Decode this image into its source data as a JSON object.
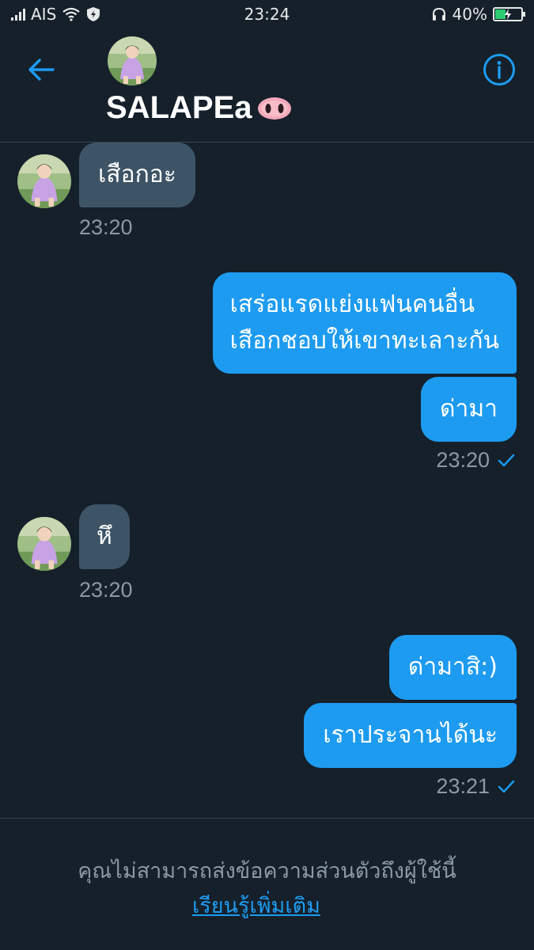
{
  "status_bar": {
    "carrier": "AIS",
    "time": "23:24",
    "battery_percent": "40%",
    "battery_level": 0.4,
    "icons": [
      "signal-icon",
      "wifi-icon",
      "shield-icon",
      "headset-icon",
      "battery-charging-icon"
    ]
  },
  "header": {
    "name": "SALAPEa",
    "name_emoji": "pig-nose-icon",
    "back_icon": "arrow-left-icon",
    "info_icon": "info-icon"
  },
  "messages": [
    {
      "direction": "received",
      "text": "เสือกอะ",
      "time": "23:20"
    },
    {
      "direction": "sent",
      "lines": [
        "เสร่อแรดแย่งแฟนคนอื่น",
        "เสือกชอบให้เขาทะเลาะกัน"
      ]
    },
    {
      "direction": "sent",
      "text": "ด่ามา",
      "time": "23:20",
      "read": true
    },
    {
      "direction": "received",
      "text": "หึ",
      "time": "23:20"
    },
    {
      "direction": "sent",
      "text": "ด่ามาสิ:)"
    },
    {
      "direction": "sent",
      "text": "เราประจานได้นะ",
      "time": "23:21",
      "read": true
    }
  ],
  "footer": {
    "notice": "คุณไม่สามารถส่งข้อความส่วนตัวถึงผู้ใช้นี้",
    "learn_more": "เรียนรู้เพิ่มเติม"
  },
  "colors": {
    "background": "#15202b",
    "received_bubble": "#3d5466",
    "sent_bubble": "#1d9bf0",
    "accent": "#1d9bf0",
    "muted_text": "#8b98a5"
  }
}
